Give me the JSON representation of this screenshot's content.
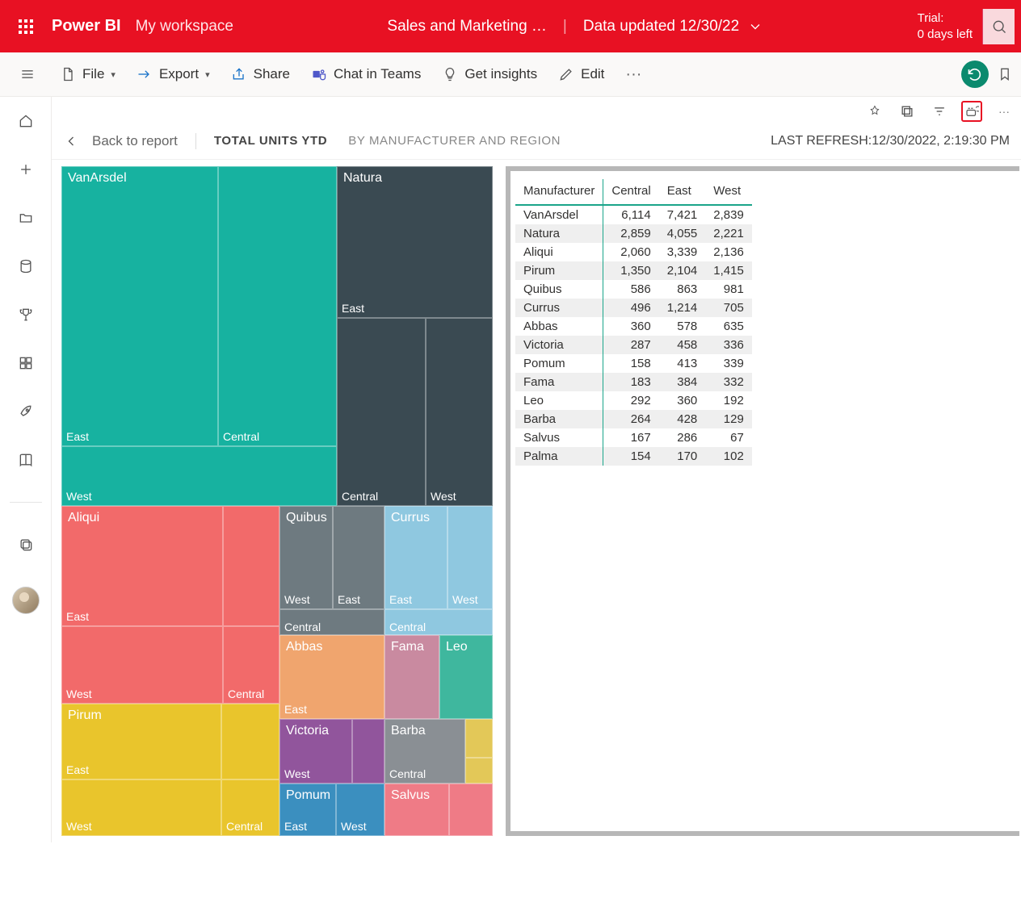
{
  "header": {
    "brand": "Power BI",
    "workspace": "My workspace",
    "report_name": "Sales and Marketing …",
    "data_updated": "Data updated 12/30/22",
    "trial_line1": "Trial:",
    "trial_line2": "0 days left"
  },
  "toolbar": {
    "file": "File",
    "export": "Export",
    "share": "Share",
    "chat": "Chat in Teams",
    "insights": "Get insights",
    "edit": "Edit"
  },
  "crumb": {
    "back": "Back to report",
    "title": "TOTAL UNITS YTD",
    "sub": "BY MANUFACTURER AND REGION",
    "last_refresh_label": "LAST REFRESH:",
    "last_refresh_value": "12/30/2022, 2:19:30 PM"
  },
  "table": {
    "columns": [
      "Manufacturer",
      "Central",
      "East",
      "West"
    ],
    "rows": [
      {
        "mfr": "VanArsdel",
        "c": "6,114",
        "e": "7,421",
        "w": "2,839"
      },
      {
        "mfr": "Natura",
        "c": "2,859",
        "e": "4,055",
        "w": "2,221"
      },
      {
        "mfr": "Aliqui",
        "c": "2,060",
        "e": "3,339",
        "w": "2,136"
      },
      {
        "mfr": "Pirum",
        "c": "1,350",
        "e": "2,104",
        "w": "1,415"
      },
      {
        "mfr": "Quibus",
        "c": "586",
        "e": "863",
        "w": "981"
      },
      {
        "mfr": "Currus",
        "c": "496",
        "e": "1,214",
        "w": "705"
      },
      {
        "mfr": "Abbas",
        "c": "360",
        "e": "578",
        "w": "635"
      },
      {
        "mfr": "Victoria",
        "c": "287",
        "e": "458",
        "w": "336"
      },
      {
        "mfr": "Pomum",
        "c": "158",
        "e": "413",
        "w": "339"
      },
      {
        "mfr": "Fama",
        "c": "183",
        "e": "384",
        "w": "332"
      },
      {
        "mfr": "Leo",
        "c": "292",
        "e": "360",
        "w": "192"
      },
      {
        "mfr": "Barba",
        "c": "264",
        "e": "428",
        "w": "129"
      },
      {
        "mfr": "Salvus",
        "c": "167",
        "e": "286",
        "w": "67"
      },
      {
        "mfr": "Palma",
        "c": "154",
        "e": "170",
        "w": "102"
      }
    ]
  },
  "treemap": {
    "labels": {
      "vanarsdel": "VanArsdel",
      "natura": "Natura",
      "aliqui": "Aliqui",
      "pirum": "Pirum",
      "quibus": "Quibus",
      "currus": "Currus",
      "abbas": "Abbas",
      "victoria": "Victoria",
      "pomum": "Pomum",
      "fama": "Fama",
      "leo": "Leo",
      "barba": "Barba",
      "salvus": "Salvus",
      "east": "East",
      "west": "West",
      "central": "Central"
    }
  },
  "chart_data": {
    "type": "treemap",
    "title": "TOTAL UNITS YTD BY MANUFACTURER AND REGION",
    "hierarchy": [
      "Manufacturer",
      "Region"
    ],
    "value_field": "Total Units YTD",
    "data": [
      {
        "manufacturer": "VanArsdel",
        "region": "East",
        "value": 7421
      },
      {
        "manufacturer": "VanArsdel",
        "region": "Central",
        "value": 6114
      },
      {
        "manufacturer": "VanArsdel",
        "region": "West",
        "value": 2839
      },
      {
        "manufacturer": "Natura",
        "region": "East",
        "value": 4055
      },
      {
        "manufacturer": "Natura",
        "region": "Central",
        "value": 2859
      },
      {
        "manufacturer": "Natura",
        "region": "West",
        "value": 2221
      },
      {
        "manufacturer": "Aliqui",
        "region": "East",
        "value": 3339
      },
      {
        "manufacturer": "Aliqui",
        "region": "Central",
        "value": 2060
      },
      {
        "manufacturer": "Aliqui",
        "region": "West",
        "value": 2136
      },
      {
        "manufacturer": "Pirum",
        "region": "East",
        "value": 2104
      },
      {
        "manufacturer": "Pirum",
        "region": "Central",
        "value": 1350
      },
      {
        "manufacturer": "Pirum",
        "region": "West",
        "value": 1415
      },
      {
        "manufacturer": "Quibus",
        "region": "East",
        "value": 863
      },
      {
        "manufacturer": "Quibus",
        "region": "Central",
        "value": 586
      },
      {
        "manufacturer": "Quibus",
        "region": "West",
        "value": 981
      },
      {
        "manufacturer": "Currus",
        "region": "East",
        "value": 1214
      },
      {
        "manufacturer": "Currus",
        "region": "Central",
        "value": 496
      },
      {
        "manufacturer": "Currus",
        "region": "West",
        "value": 705
      },
      {
        "manufacturer": "Abbas",
        "region": "East",
        "value": 578
      },
      {
        "manufacturer": "Abbas",
        "region": "Central",
        "value": 360
      },
      {
        "manufacturer": "Abbas",
        "region": "West",
        "value": 635
      },
      {
        "manufacturer": "Victoria",
        "region": "East",
        "value": 458
      },
      {
        "manufacturer": "Victoria",
        "region": "Central",
        "value": 287
      },
      {
        "manufacturer": "Victoria",
        "region": "West",
        "value": 336
      },
      {
        "manufacturer": "Pomum",
        "region": "East",
        "value": 413
      },
      {
        "manufacturer": "Pomum",
        "region": "Central",
        "value": 158
      },
      {
        "manufacturer": "Pomum",
        "region": "West",
        "value": 339
      },
      {
        "manufacturer": "Fama",
        "region": "East",
        "value": 384
      },
      {
        "manufacturer": "Fama",
        "region": "Central",
        "value": 183
      },
      {
        "manufacturer": "Fama",
        "region": "West",
        "value": 332
      },
      {
        "manufacturer": "Leo",
        "region": "East",
        "value": 360
      },
      {
        "manufacturer": "Leo",
        "region": "Central",
        "value": 292
      },
      {
        "manufacturer": "Leo",
        "region": "West",
        "value": 192
      },
      {
        "manufacturer": "Barba",
        "region": "East",
        "value": 428
      },
      {
        "manufacturer": "Barba",
        "region": "Central",
        "value": 264
      },
      {
        "manufacturer": "Barba",
        "region": "West",
        "value": 129
      },
      {
        "manufacturer": "Salvus",
        "region": "East",
        "value": 286
      },
      {
        "manufacturer": "Salvus",
        "region": "Central",
        "value": 167
      },
      {
        "manufacturer": "Salvus",
        "region": "West",
        "value": 67
      },
      {
        "manufacturer": "Palma",
        "region": "East",
        "value": 170
      },
      {
        "manufacturer": "Palma",
        "region": "Central",
        "value": 154
      },
      {
        "manufacturer": "Palma",
        "region": "West",
        "value": 102
      }
    ],
    "colors": {
      "VanArsdel": "#17b2a0",
      "Natura": "#3a4a52",
      "Aliqui": "#f26a6a",
      "Pirum": "#e9c52c",
      "Quibus": "#6e7a80",
      "Currus": "#8fc8e0",
      "Abbas": "#f0a56e",
      "Victoria": "#91559c",
      "Pomum": "#3b8fbf",
      "Fama": "#c98aa0",
      "Leo": "#3fb79e",
      "Barba": "#8a8f94",
      "Salvus": "#ef7b86",
      "Palma": "#e3c858"
    }
  }
}
